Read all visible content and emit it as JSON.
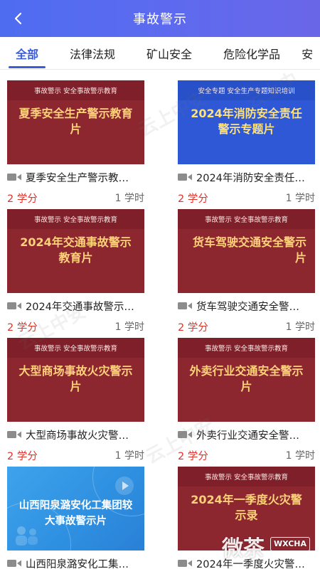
{
  "header": {
    "title": "事故警示"
  },
  "tabs": [
    {
      "label": "全部",
      "active": true
    },
    {
      "label": "法律法规"
    },
    {
      "label": "矿山安全"
    },
    {
      "label": "危险化学品"
    },
    {
      "label": "安"
    }
  ],
  "cards": [
    {
      "theme": "red",
      "strip": "事故警示 安全事故警示教育",
      "thumb_title": "夏季安全生产警示教育片",
      "title": "夏季安全生产警示教…",
      "credit": "2 学分",
      "hours": "1 学时"
    },
    {
      "theme": "blue",
      "strip": "安全专题 安全生产专题知识培训",
      "thumb_title": "2024年消防安全责任警示专题片",
      "title": "2024年消防安全责任…",
      "credit": "2 学分",
      "hours": "1 学时"
    },
    {
      "theme": "red",
      "strip": "事故警示 安全事故警示教育",
      "thumb_title": "2024年交通事故警示教育片",
      "title": "2024年交通事故警示…",
      "credit": "2 学分",
      "hours": "1 学时"
    },
    {
      "theme": "red",
      "strip": "事故警示 安全事故警示教育",
      "thumb_title": "货车驾驶交通安全警示片",
      "title": "货车驾驶交通安全警…",
      "credit": "2 学分",
      "hours": "1 学时"
    },
    {
      "theme": "red",
      "strip": "事故警示 安全事故警示教育",
      "thumb_title": "大型商场事故火灾警示片",
      "title": "大型商场事故火灾警…",
      "credit": "2 学分",
      "hours": "1 学时"
    },
    {
      "theme": "red",
      "strip": "事故警示 安全事故警示教育",
      "thumb_title": "外卖行业交通安全警示片",
      "title": "外卖行业交通安全警…",
      "credit": "2 学分",
      "hours": "1 学时"
    },
    {
      "theme": "special",
      "strip": "",
      "thumb_title": "山西阳泉潞安化工集团较大事故警示片",
      "title": "山西阳泉潞安化工集…",
      "credit": "",
      "hours": ""
    },
    {
      "theme": "red",
      "strip": "事故警示 安全事故警示教育",
      "thumb_title": "2024年一季度火灾警示录",
      "title": "2024年一季度火灾警…",
      "credit": "",
      "hours": ""
    }
  ],
  "watermark_text": "云上中安",
  "brand": {
    "name": "微茶",
    "tag": "WXCHA"
  },
  "colors": {
    "header": "#5869ee",
    "accent": "#3b5bd9",
    "credit": "#e0342c",
    "thumb_red": "#8c2730",
    "thumb_blue": "#2f58d6"
  }
}
